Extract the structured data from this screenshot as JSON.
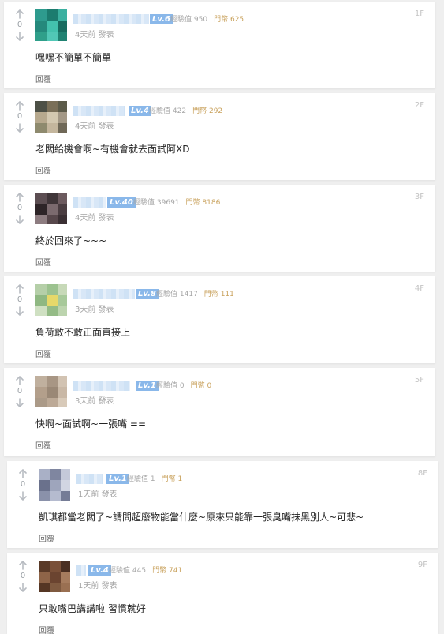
{
  "stats_labels": {
    "exp": "經驗值",
    "coins": "門幣"
  },
  "posts": [
    {
      "floor": "1F",
      "votes": "0",
      "level": "Lv.6",
      "exp": "950",
      "coins": "625",
      "time": "4天前 發表",
      "content": "嘿嘿不簡單不簡單",
      "reply": "回覆",
      "avatar_colors": [
        "#2e9b8e",
        "#1c7c6f",
        "#3bb0a0",
        "#25897c",
        "#43c1ad",
        "#176b5f",
        "#2f9f8a",
        "#51c7b6",
        "#208272"
      ]
    },
    {
      "floor": "2F",
      "votes": "0",
      "level": "Lv.4",
      "exp": "422",
      "coins": "292",
      "time": "4天前 發表",
      "content": "老闆給機會啊~有機會就去面試阿XD",
      "reply": "回覆",
      "avatar_colors": [
        "#4d5046",
        "#7a6f58",
        "#5c5b4a",
        "#b7a98e",
        "#d3c8b0",
        "#a39886",
        "#8e8a6e",
        "#c4b69d",
        "#6f6857"
      ]
    },
    {
      "floor": "3F",
      "votes": "0",
      "level": "Lv.40",
      "exp": "39691",
      "coins": "8186",
      "time": "4天前 發表",
      "content": "終於回來了~~~",
      "reply": "回覆",
      "avatar_colors": [
        "#5c4e52",
        "#3f3538",
        "#6c5a5e",
        "#2d2427",
        "#7b6a6e",
        "#4a3d41",
        "#8d7c80",
        "#57474b",
        "#3a2f33"
      ]
    },
    {
      "floor": "4F",
      "votes": "0",
      "level": "Lv.8",
      "exp": "1417",
      "coins": "111",
      "time": "3天前 發表",
      "content": "負荷敢不敢正面直接上",
      "reply": "回覆",
      "avatar_colors": [
        "#b5cfa8",
        "#9cc28f",
        "#c7d9b8",
        "#8fb882",
        "#e6d86a",
        "#a7c99a",
        "#cfe0c2",
        "#94bb86",
        "#bcd4ae"
      ]
    },
    {
      "floor": "5F",
      "votes": "0",
      "level": "Lv.1",
      "exp": "0",
      "coins": "0",
      "time": "3天前 發表",
      "content": "快啊~面試啊~一張嘴 ==",
      "reply": "回覆",
      "avatar_colors": [
        "#c0b09e",
        "#a89684",
        "#d2c3b2",
        "#b39f8b",
        "#9a8876",
        "#c9b8a6",
        "#ab9a88",
        "#bca996",
        "#d8cab9"
      ]
    },
    {
      "floor": "8F",
      "votes": "0",
      "level": "Lv.1",
      "exp": "1",
      "coins": "1",
      "time": "1天前 發表",
      "content": "凱琪都當老闆了~請問超廢物能當什麼~原來只能靠一張臭嘴抹黑別人~可悲~",
      "reply": "回覆",
      "avatar_colors": [
        "#a9b0c6",
        "#7f86a0",
        "#c4c9d9",
        "#6a718c",
        "#9ea5bc",
        "#d1d5e2",
        "#8a91aa",
        "#b5bbcf",
        "#757c96"
      ]
    },
    {
      "floor": "9F",
      "votes": "0",
      "level": "Lv.4",
      "exp": "445",
      "coins": "741",
      "time": "1天前 發表",
      "content": "只敢嘴巴講講啦 習慣就好",
      "reply": "回覆",
      "avatar_colors": [
        "#5a3a28",
        "#7a5038",
        "#4a2f22",
        "#8e6448",
        "#6b4430",
        "#a67c5e",
        "#553624",
        "#7f5a40",
        "#9a7052"
      ]
    }
  ]
}
